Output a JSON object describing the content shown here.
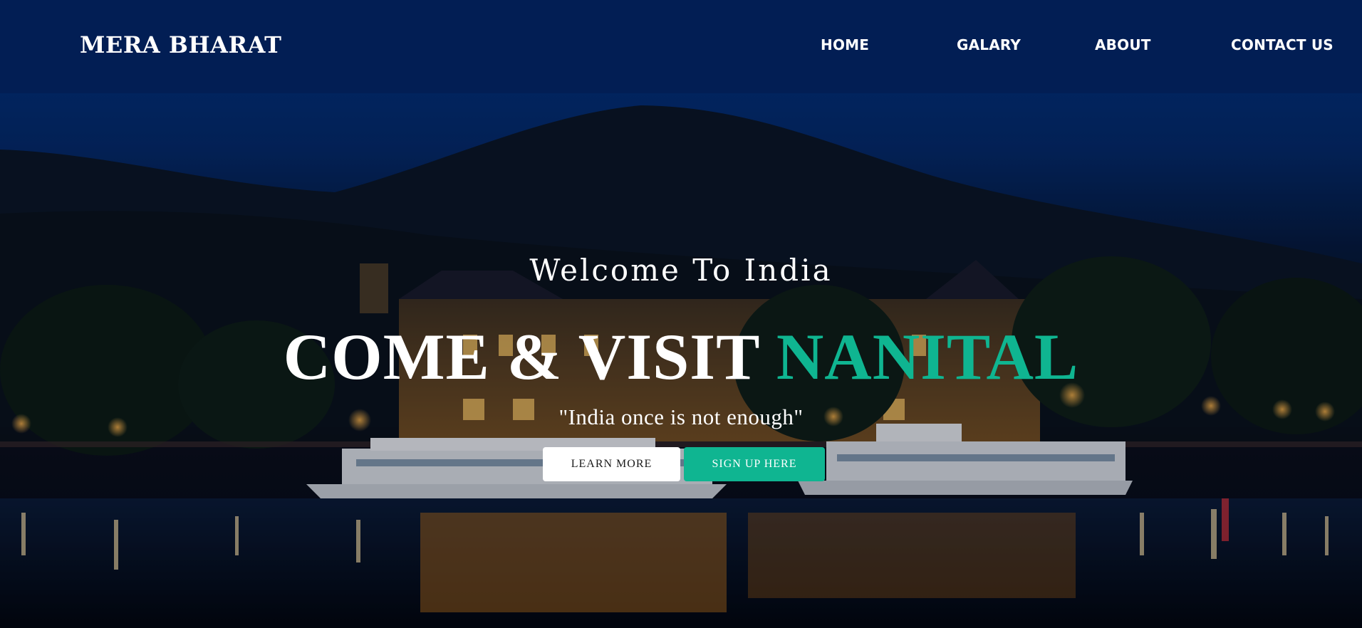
{
  "brand": {
    "name": "MERA BHARAT"
  },
  "nav": {
    "items": [
      {
        "label": "HOME"
      },
      {
        "label": "GALARY"
      },
      {
        "label": "ABOUT"
      },
      {
        "label": "CONTACT US"
      }
    ]
  },
  "hero": {
    "welcome": "Welcome To India",
    "headline_main": "COME & VISIT ",
    "headline_accent": "NANITAL",
    "tagline": "\"India once is not enough\"",
    "learn_more_label": "LEARN MORE",
    "sign_up_label": "SIGN UP HERE"
  },
  "colors": {
    "accent": "#0fb591",
    "navbar": "#021e54",
    "sky": "#022e78"
  },
  "background": {
    "icon": "night-city-lake-photo"
  }
}
